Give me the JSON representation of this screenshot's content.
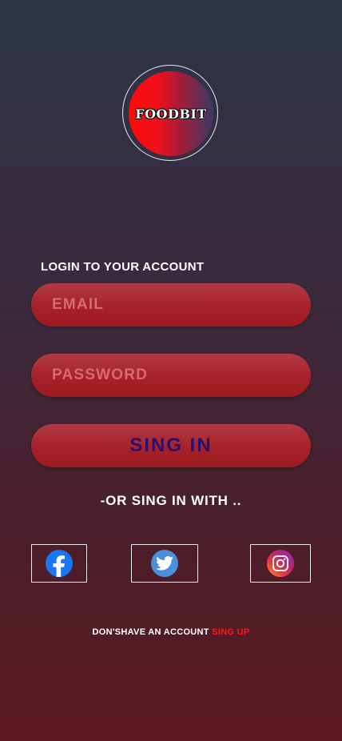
{
  "logo": {
    "text": "FOODBIT"
  },
  "login": {
    "heading": "LOGIN TO YOUR ACCOUNT",
    "email_placeholder": "EMAIL",
    "password_placeholder": "PASSWORD",
    "signin_label": "SING IN"
  },
  "social": {
    "heading": "-OR SING IN WITH ..",
    "icons": [
      "facebook-icon",
      "twitter-icon",
      "instagram-icon"
    ]
  },
  "footer": {
    "prompt": "DON'SHAVE AN ACCOUNT",
    "signup_label": "SING UP"
  },
  "colors": {
    "field_bg": "#a6222a",
    "signin_text": "#2a0f6e",
    "signup_link": "#ff1a1a",
    "facebook": "#1877f2",
    "twitter": "#4a90d9"
  }
}
